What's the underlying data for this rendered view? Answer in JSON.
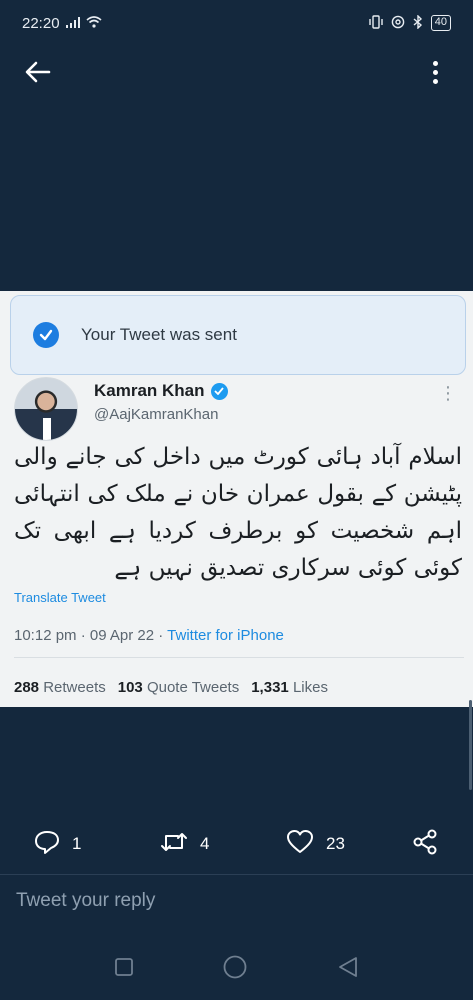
{
  "status_bar": {
    "time": "22:20",
    "battery": "40"
  },
  "toast": {
    "text": "Your Tweet was sent"
  },
  "tweet": {
    "author_name": "Kamran Khan",
    "author_handle": "@AajKamranKhan",
    "body": "اسلام آباد ہائی کورٹ میں داخل کی جانے والی پٹیشن کے بقول عمران خان نے ملک کی انتہائی اہم شخصیت کو برطرف کردیا ہے ابھی تک کوئی کوئی سرکاری تصدیق نہیں ہے",
    "translate_label": "Translate Tweet",
    "time": "10:12 pm · 09 Apr 22 · ",
    "source": "Twitter for iPhone",
    "retweets_count": "288",
    "retweets_label": "Retweets",
    "quote_count": "103",
    "quote_label": "Quote Tweets",
    "likes_count": "1,331",
    "likes_label": "Likes"
  },
  "actions": {
    "replies": "1",
    "retweets": "4",
    "likes": "23"
  },
  "reply_box": {
    "placeholder": "Tweet your reply"
  },
  "colors": {
    "background": "#14283d",
    "accent": "#1d9bf0"
  }
}
